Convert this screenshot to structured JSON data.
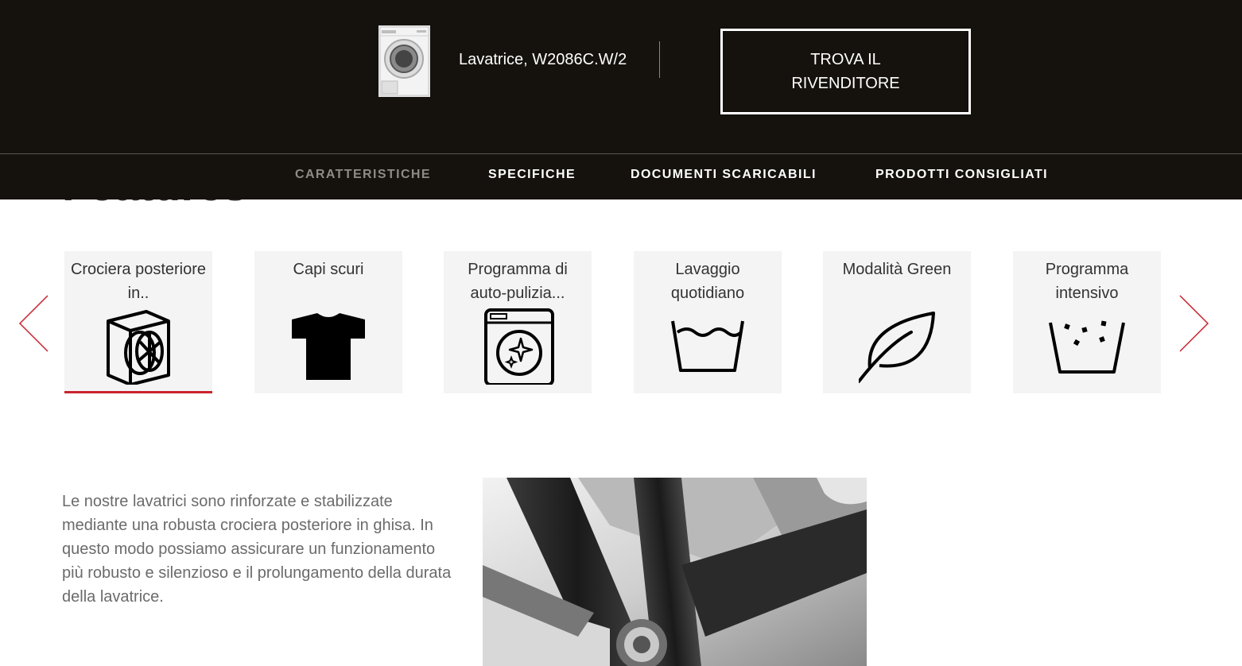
{
  "header": {
    "product_name": "Lavatrice, W2086C.W/2",
    "dealer_button": "TROVA IL RIVENDITORE"
  },
  "subnav": {
    "items": [
      {
        "label": "CARATTERISTICHE",
        "active": true
      },
      {
        "label": "SPECIFICHE",
        "active": false
      },
      {
        "label": "DOCUMENTI SCARICABILI",
        "active": false
      },
      {
        "label": "PRODOTTI CONSIGLIATI",
        "active": false
      }
    ]
  },
  "section": {
    "heading": "Features"
  },
  "features": [
    {
      "label": "Crociera posteriore in..",
      "icon": "drum-spider-icon",
      "active": true
    },
    {
      "label": "Capi scuri",
      "icon": "tshirt-icon",
      "active": false
    },
    {
      "label": "Programma di auto-pulizia...",
      "icon": "self-clean-washer-icon",
      "active": false
    },
    {
      "label": "Lavaggio quotidiano",
      "icon": "wash-tub-icon",
      "active": false
    },
    {
      "label": "Modalità Green",
      "icon": "leaf-icon",
      "active": false
    },
    {
      "label": "Programma intensivo",
      "icon": "intensive-wash-icon",
      "active": false
    }
  ],
  "description": "Le nostre lavatrici sono rinforzate e stabilizzate mediante una robusta crociera posteriore in ghisa. In questo modo possiamo assicurare un funzionamento più robusto e silenzioso e il prolungamento della durata della lavatrice.",
  "colors": {
    "header_bg": "#15110d",
    "accent": "#c8242f",
    "card_bg": "#f4f4f4",
    "body_text": "#6b6b6b"
  }
}
